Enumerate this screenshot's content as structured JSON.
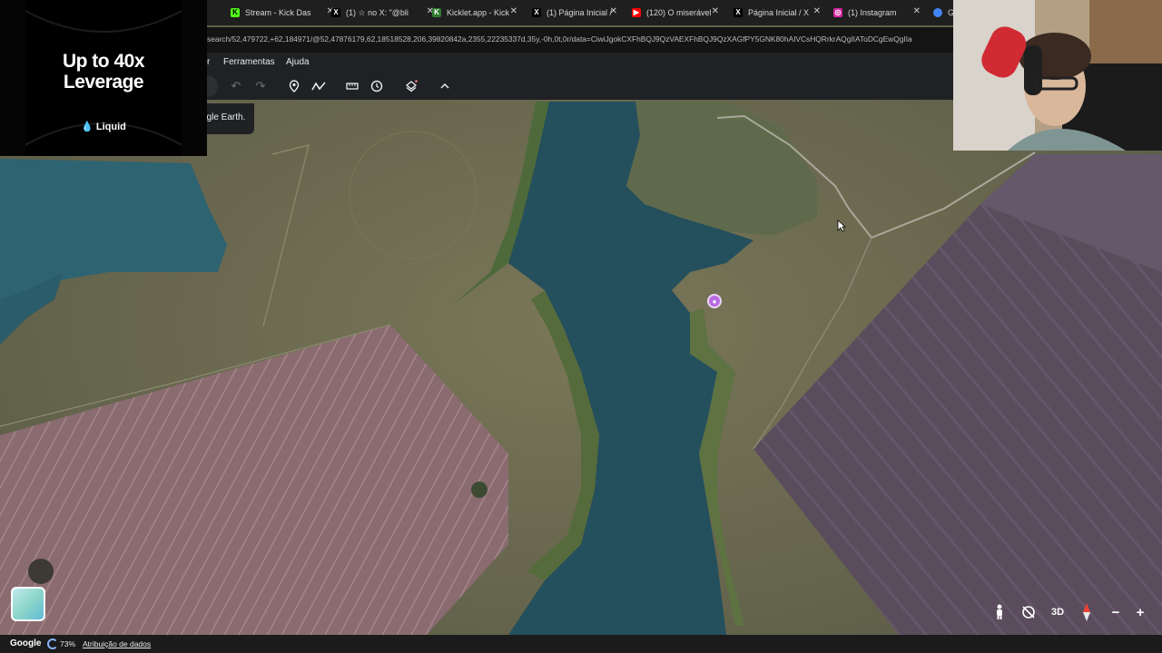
{
  "ad": {
    "headline_line1": "Up to 40x",
    "headline_line2": "Leverage",
    "brand": "Liquid"
  },
  "tabs": [
    {
      "label": "Stream - Kick Das",
      "icon": "kick-icon",
      "color": "#53fc18"
    },
    {
      "label": "(1) ☆ no X: \"@bli",
      "icon": "x-icon",
      "color": "#000000"
    },
    {
      "label": "Kicklet.app - Kick",
      "icon": "kicklet-icon",
      "color": "#2e7d32"
    },
    {
      "label": "(1) Página Inicial /",
      "icon": "x-icon",
      "color": "#000000"
    },
    {
      "label": "(120) O miserável",
      "icon": "youtube-icon",
      "color": "#ff0000"
    },
    {
      "label": "Página Inicial / X",
      "icon": "x-icon",
      "color": "#000000"
    },
    {
      "label": "(1) Instagram",
      "icon": "instagram-icon",
      "color": "#d6249f"
    },
    {
      "label": "G",
      "icon": "earth-icon",
      "color": "#4285f4"
    }
  ],
  "url": "search/52,479722,+62,184971/@52,47876179,62,18518528,206,39820842a,2355,22235337d,35y,-0h,0t,0r/data=CiwiJgokCXFhBQJ9QzVAEXFhBQJ9QzXAGfPY5GNK80hAIVCsHQRrkrAQgIIAToDCgEwQgIIa",
  "menu": {
    "partial_item": "r",
    "tools_label": "Ferramentas",
    "help_label": "Ajuda"
  },
  "earth_chip": "ogle Earth.",
  "map_controls": {
    "three_d_label": "3D"
  },
  "footer": {
    "logo": "Google",
    "loading_pct": "73%",
    "attribution": "Atribuição de dados"
  }
}
